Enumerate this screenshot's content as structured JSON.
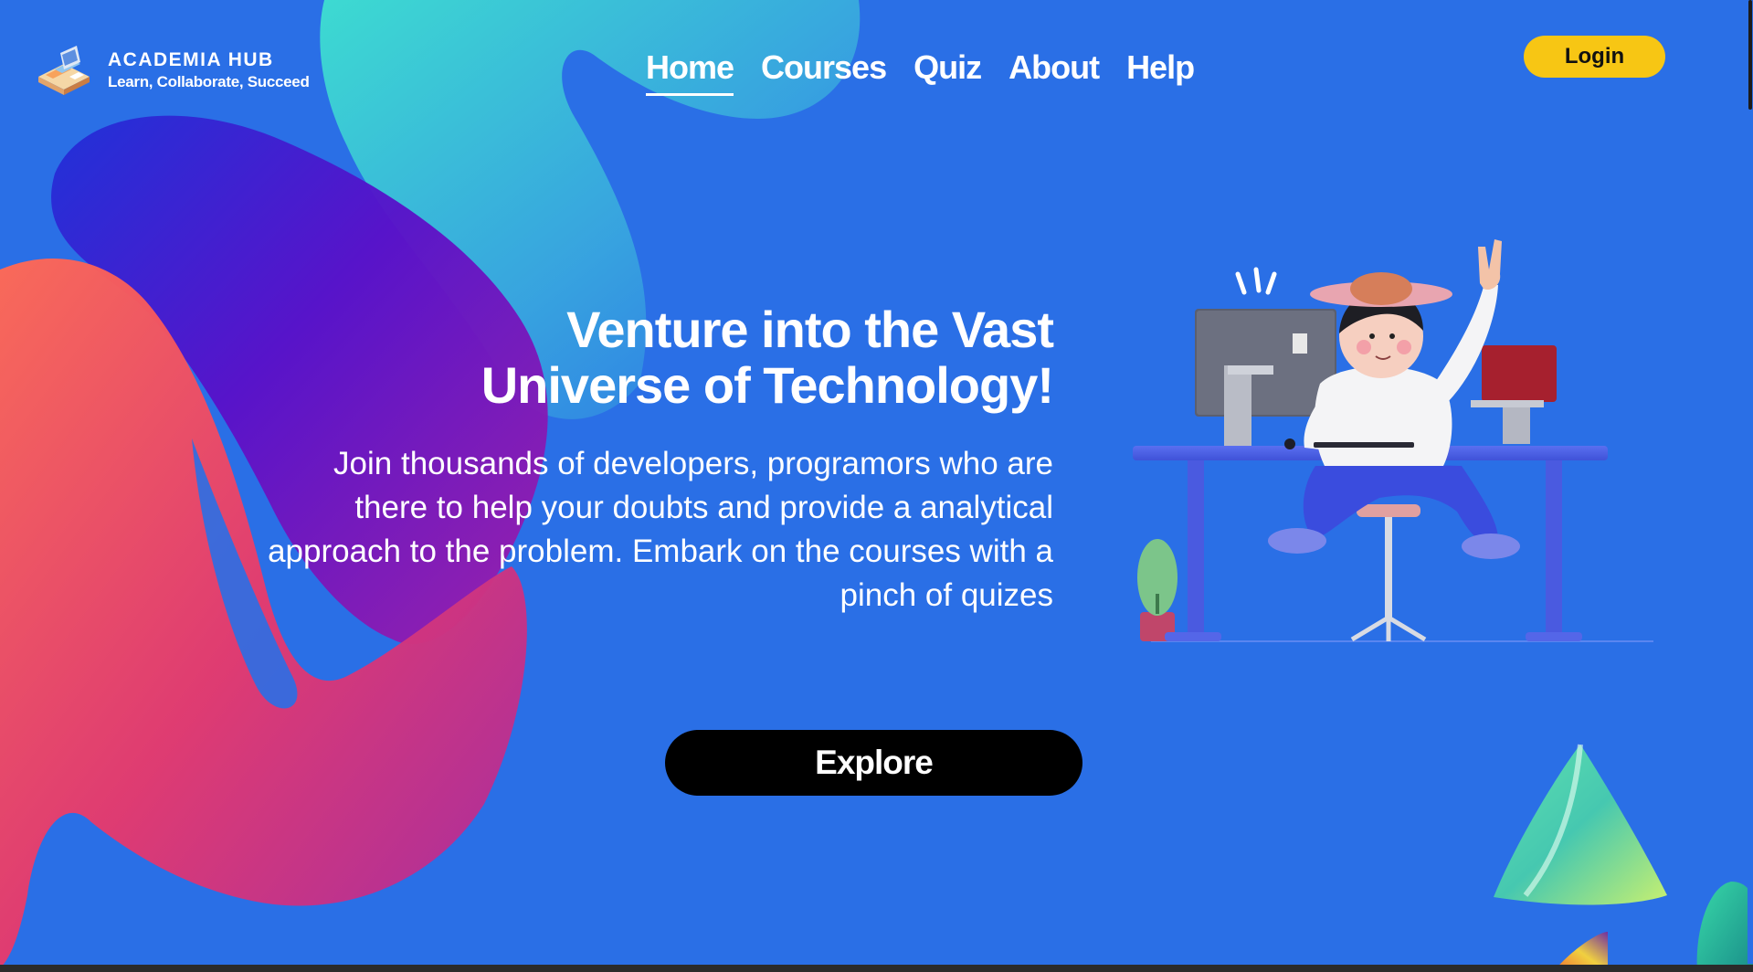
{
  "brand": {
    "name": "ACADEMIA HUB",
    "tagline": "Learn, Collaborate, Succeed",
    "logo_icon": "laptop-books-icon"
  },
  "nav": {
    "items": [
      {
        "label": "Home",
        "active": true
      },
      {
        "label": "Courses",
        "active": false
      },
      {
        "label": "Quiz",
        "active": false
      },
      {
        "label": "About",
        "active": false
      },
      {
        "label": "Help",
        "active": false
      }
    ]
  },
  "header": {
    "login_label": "Login"
  },
  "hero": {
    "title_line1": "Venture into the Vast",
    "title_line2": "Universe of Technology!",
    "description": "Join thousands of developers, programors who are there to help your doubts and provide a analytical approach to the problem. Embark on the courses with a pinch of quizes",
    "explore_label": "Explore",
    "illustration": "developer-at-desk-illustration"
  },
  "colors": {
    "background": "#2a6fe6",
    "login_button": "#f7c614",
    "explore_button": "#000000",
    "text": "#ffffff"
  }
}
